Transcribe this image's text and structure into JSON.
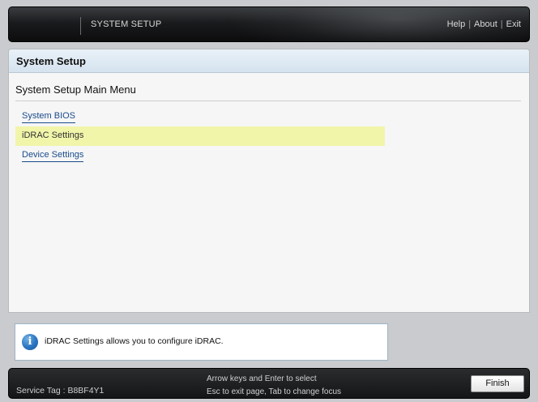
{
  "header": {
    "title": "SYSTEM SETUP",
    "links": {
      "help": "Help",
      "about": "About",
      "exit": "Exit",
      "separator": "|"
    }
  },
  "panel": {
    "heading": "System Setup",
    "menu_title": "System Setup Main Menu",
    "items": [
      {
        "label": "System BIOS",
        "selected": false
      },
      {
        "label": "iDRAC Settings",
        "selected": true
      },
      {
        "label": "Device Settings",
        "selected": false
      }
    ]
  },
  "info": {
    "icon": "info-icon",
    "glyph": "i",
    "text": "iDRAC Settings allows you to configure iDRAC."
  },
  "footer": {
    "service_tag_label": "Service Tag :",
    "service_tag_value": "B8BF4Y1",
    "hint_line1": "Arrow keys and Enter to select",
    "hint_line2": "Esc to exit page, Tab to change focus",
    "finish_label": "Finish"
  },
  "colors": {
    "selected_row": "#f1f5a9",
    "link": "#1a4b8c",
    "panel_header": "#d5e3ef"
  }
}
